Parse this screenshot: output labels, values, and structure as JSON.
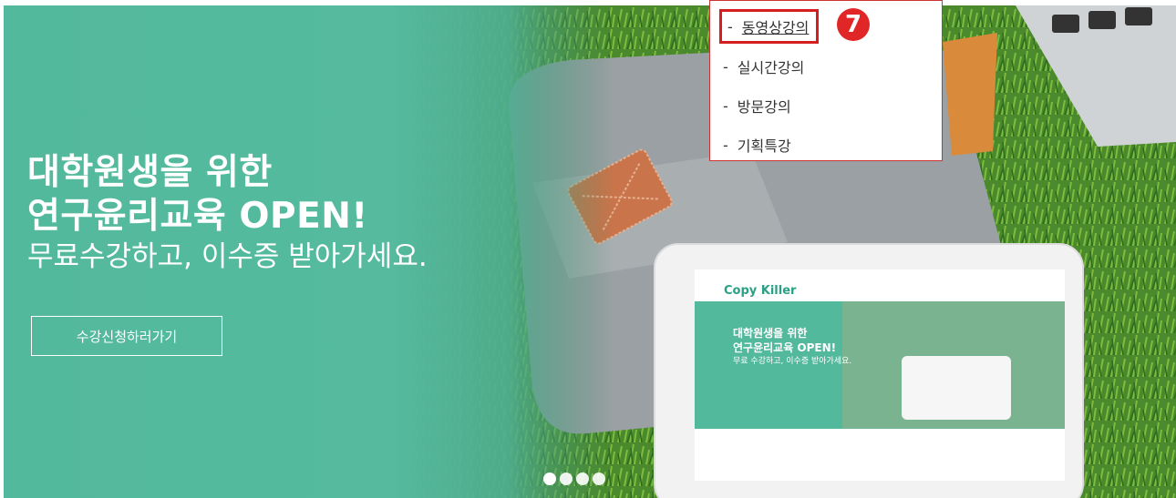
{
  "hero": {
    "headline_line1": "대학원생을 위한",
    "headline_line2": "연구윤리교육 OPEN!",
    "headline_line3": "무료수강하고, 이수증 받아가세요.",
    "cta_label": "수강신청하러가기",
    "carousel_dots": 4
  },
  "tablet_preview": {
    "brand": "Copy Killer",
    "headline_line1": "대학원생을 위한",
    "headline_line2": "연구윤리교육 OPEN!",
    "headline_line3": "무료 수강하고, 이수증 받아가세요."
  },
  "dropdown": {
    "items": [
      {
        "label": "동영상강의",
        "dash": "-"
      },
      {
        "label": "실시간강의",
        "dash": "-"
      },
      {
        "label": "방문강의",
        "dash": "-"
      },
      {
        "label": "기획특강",
        "dash": "-"
      }
    ],
    "annotation_marker": "7"
  },
  "colors": {
    "teal": "#53b99d",
    "grass": "#4e8a2a",
    "highlight_red": "#d61e1e"
  }
}
